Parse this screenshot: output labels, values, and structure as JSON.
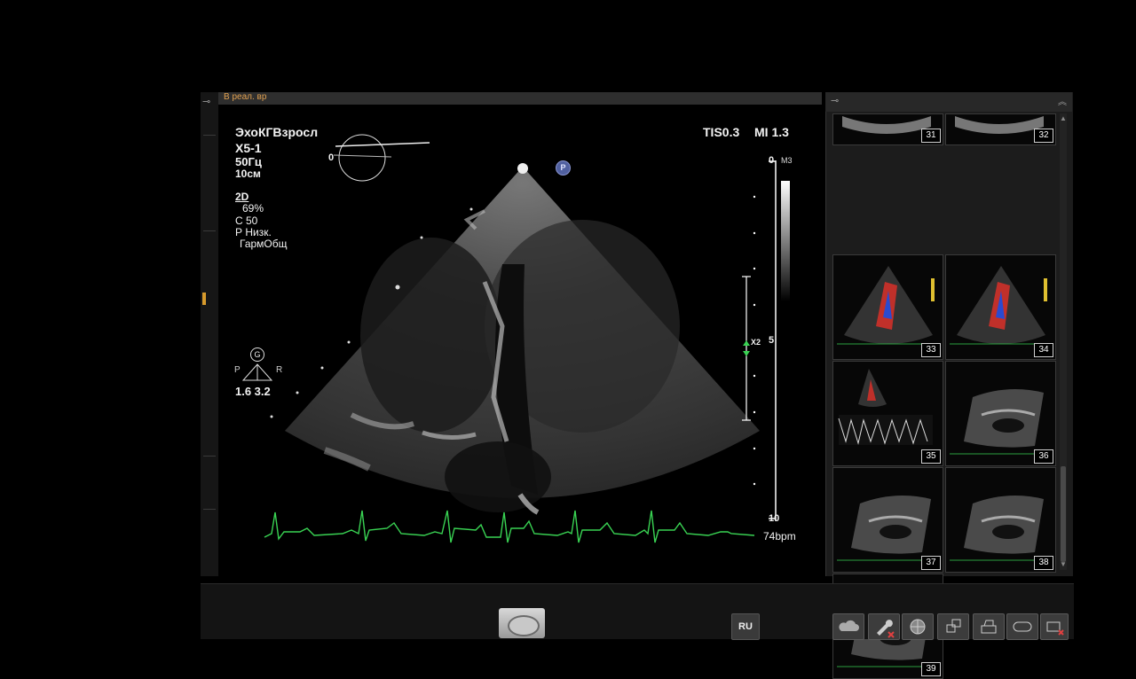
{
  "top_bar": {
    "mode_tab": "В реал. вр"
  },
  "overlay": {
    "preset": "ЭхоКГВзросл",
    "probe": "X5-1",
    "frame_rate": "50Гц",
    "depth": "10см",
    "mode": "2D",
    "gain": "69%",
    "compression": "С 50",
    "resolution": "Р Низк.",
    "harmonics": "ГармОбщ",
    "tis": "TIS0.3",
    "mi": "MI 1.3",
    "angle": "0",
    "p_badge": "P",
    "g_badge": "G",
    "orientation_left": "P",
    "orientation_right": "R",
    "focus_values": "1.6  3.2",
    "zoom": "X2"
  },
  "depth_scale": {
    "unit": "М3",
    "top": "0",
    "mid": "5",
    "bottom": "10"
  },
  "ecg": {
    "heart_rate": "74bpm",
    "color": "#39d353"
  },
  "thumbnails": [
    {
      "num": "31",
      "kind": "2d-top"
    },
    {
      "num": "32",
      "kind": "2d-top"
    },
    {
      "num": "33",
      "kind": "color-doppler"
    },
    {
      "num": "34",
      "kind": "color-doppler"
    },
    {
      "num": "35",
      "kind": "spectral-doppler"
    },
    {
      "num": "36",
      "kind": "2d"
    },
    {
      "num": "37",
      "kind": "2d"
    },
    {
      "num": "38",
      "kind": "2d"
    },
    {
      "num": "39",
      "kind": "2d"
    }
  ],
  "bottom_bar": {
    "language": "RU",
    "tools": [
      "cloud-icon",
      "wrench-icon",
      "globe-icon",
      "network-icon",
      "printer-icon",
      "eject-icon",
      "disconnect-icon"
    ]
  }
}
